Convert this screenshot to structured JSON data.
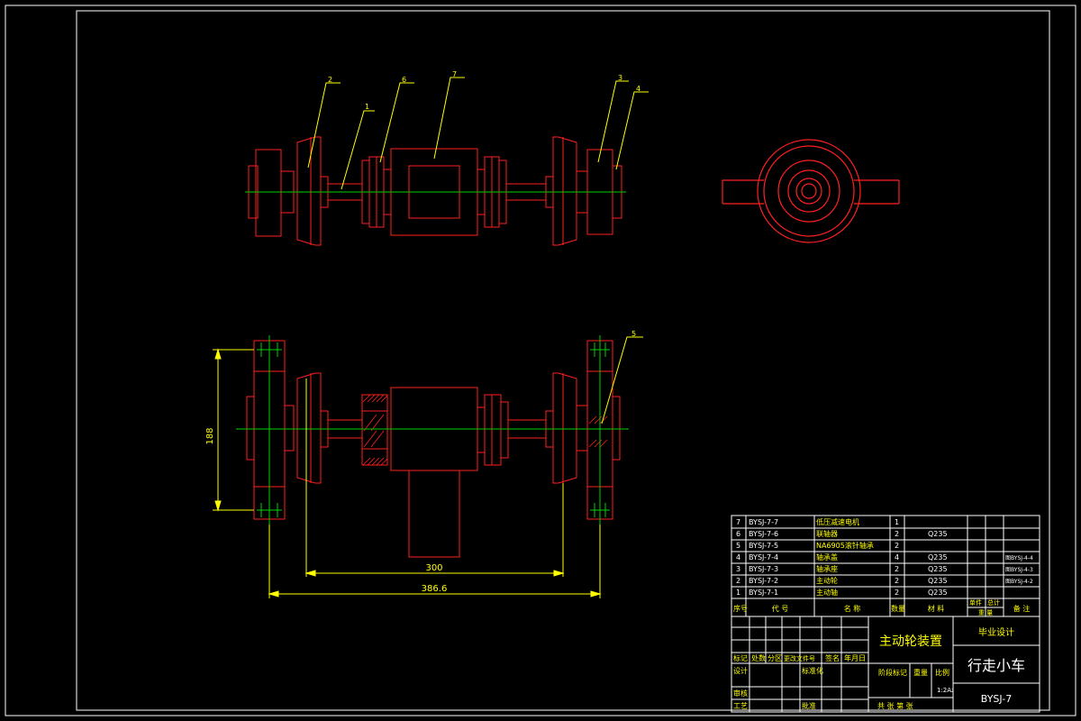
{
  "colors": {
    "background": "#000000",
    "frame": "#ffffff",
    "outline": "#ff2020",
    "centerline": "#00d000",
    "leader": "#ffff00",
    "dimension": "#ffff00",
    "table_text": "#ffffff",
    "table_cjk": "#ffff00"
  },
  "balloons": [
    "2",
    "6",
    "7",
    "1",
    "3",
    "4",
    "5"
  ],
  "dimensions": {
    "height": "188",
    "span_inner": "300",
    "span_outer": "386.6"
  },
  "bom": {
    "rows": [
      {
        "no": "7",
        "code": "BYSJ-7-7",
        "name": "低压减速电机",
        "qty": "1",
        "material": "",
        "note": ""
      },
      {
        "no": "6",
        "code": "BYSJ-7-6",
        "name": "联轴器",
        "qty": "2",
        "material": "Q235",
        "note": ""
      },
      {
        "no": "5",
        "code": "BYSJ-7-5",
        "name": "NA6905滚针轴承",
        "qty": "2",
        "material": "",
        "note": ""
      },
      {
        "no": "4",
        "code": "BYSJ-7-4",
        "name": "轴承盖",
        "qty": "4",
        "material": "Q235",
        "note": "图BYSJ-4-4"
      },
      {
        "no": "3",
        "code": "BYSJ-7-3",
        "name": "轴承座",
        "qty": "2",
        "material": "Q235",
        "note": "图BYSJ-4-3"
      },
      {
        "no": "2",
        "code": "BYSJ-7-2",
        "name": "主动轮",
        "qty": "2",
        "material": "Q235",
        "note": "图BYSJ-4-2"
      },
      {
        "no": "1",
        "code": "BYSJ-7-1",
        "name": "主动轴",
        "qty": "2",
        "material": "Q235",
        "note": ""
      }
    ],
    "header": {
      "no": "序号",
      "code": "代 号",
      "name": "名 称",
      "qty": "数量",
      "material": "材 料",
      "unit_weight": "单件",
      "total_weight": "总计",
      "weight": "重 量",
      "note": "备 注"
    }
  },
  "title_block": {
    "drawing_title": "主动轮装置",
    "project": "毕业设计",
    "product": "行走小车",
    "drawing_no": "BYSJ-7",
    "rev_headers": [
      "标记",
      "处数",
      "分区",
      "更改文件号",
      "签名",
      "年月日"
    ],
    "design": "设计",
    "standardize": "标准化",
    "review": "审核",
    "process": "工艺",
    "approve": "批准",
    "stage_mark": "阶段标记",
    "weight": "重量",
    "scale": "比例",
    "sheet_size": "1:2A₂",
    "sheets": "共 张 第 张"
  }
}
